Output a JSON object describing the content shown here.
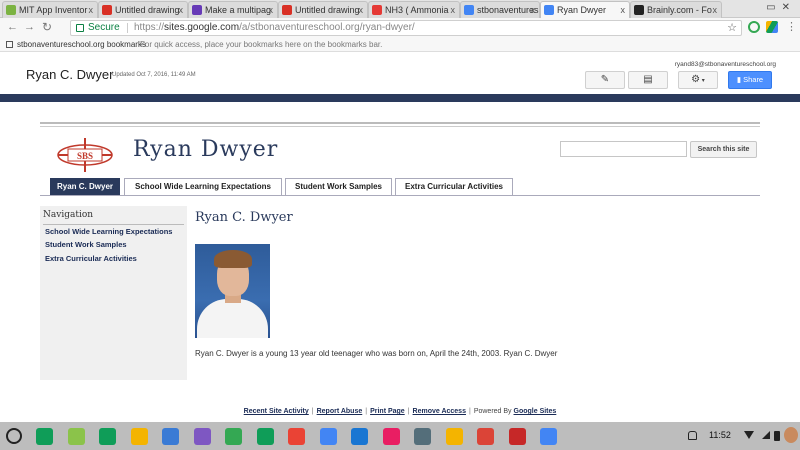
{
  "browser": {
    "tabs": [
      {
        "title": "MIT App Inventor",
        "color": "#7cb342"
      },
      {
        "title": "Untitled drawing",
        "color": "#d93025"
      },
      {
        "title": "Make a multipag",
        "color": "#673ab7"
      },
      {
        "title": "Untitled drawing",
        "color": "#d93025"
      },
      {
        "title": "NH3 ( Ammonia",
        "color": "#e53935"
      },
      {
        "title": "stbonaventures",
        "color": "#4285f4"
      },
      {
        "title": "Ryan Dwyer",
        "color": "#4285f4",
        "active": true
      },
      {
        "title": "Brainly.com - Fo",
        "color": "#222222"
      }
    ],
    "tab_close": "x",
    "secure_label": "Secure",
    "url_scheme": "https://",
    "url_host": "sites.google.com",
    "url_path": "/a/stbonaventureschool.org/ryan-dwyer/",
    "bookmarks_label": "stbonaventureschool.org bookmarks",
    "bookmarks_hint": "For quick access, place your bookmarks here on the bookmarks bar."
  },
  "site_header": {
    "page_title": "Ryan C. Dwyer",
    "updated": "Updated Oct 7, 2016, 11:49 AM",
    "user_email": "ryand83@stbonaventureschool.org",
    "share_label": "Share"
  },
  "site": {
    "name": "Ryan Dwyer",
    "logo_text": "SBS",
    "search_button": "Search this site",
    "tabs": [
      "Ryan C. Dwyer",
      "School Wide Learning Expectations",
      "Student Work Samples",
      "Extra Curricular Activities"
    ]
  },
  "sidebar": {
    "title": "Navigation",
    "links": [
      "School Wide Learning Expectations",
      "Student Work Samples",
      "Extra Curricular Activities"
    ]
  },
  "main": {
    "heading": "Ryan C. Dwyer",
    "bio": "Ryan C. Dwyer is a young 13 year old teenager who was born on, April the 24th, 2003. Ryan C. Dwyer"
  },
  "footer": {
    "links": [
      "Recent Site Activity",
      "Report Abuse",
      "Print Page",
      "Remove Access"
    ],
    "powered_by": "Powered By",
    "google_sites": "Google Sites"
  },
  "shelf": {
    "time": "11:52",
    "app_colors": [
      "#0f9d58",
      "#8bc34a",
      "#0f9d58",
      "#f4b400",
      "#3a7bd5",
      "#7e57c2",
      "#34a853",
      "#0f9d58",
      "#ea4335",
      "#4285f4",
      "#1976d2",
      "#e91e63",
      "#546e7a",
      "#f4b400",
      "#db4437",
      "#c62828",
      "#4285f4"
    ]
  }
}
